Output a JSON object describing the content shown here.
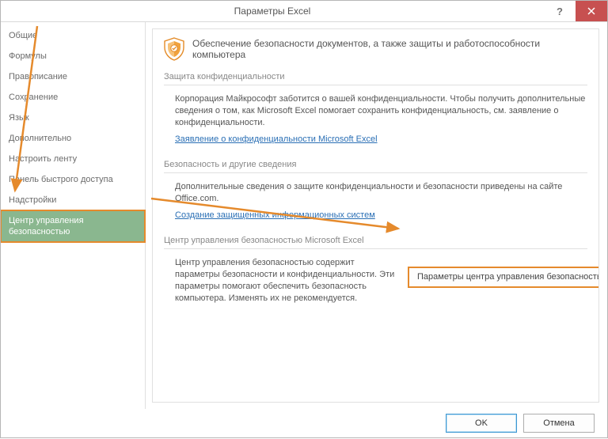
{
  "title": "Параметры Excel",
  "sidebar": {
    "items": [
      {
        "label": "Общие"
      },
      {
        "label": "Формулы"
      },
      {
        "label": "Правописание"
      },
      {
        "label": "Сохранение"
      },
      {
        "label": "Язык"
      },
      {
        "label": "Дополнительно"
      },
      {
        "label": "Настроить ленту"
      },
      {
        "label": "Панель быстрого доступа"
      },
      {
        "label": "Надстройки"
      },
      {
        "label": "Центр управления безопасностью"
      }
    ],
    "selected_index": 9
  },
  "main": {
    "header": "Обеспечение безопасности документов, а также защиты и работоспособности компьютера",
    "sections": [
      {
        "title": "Защита конфиденциальности",
        "text": "Корпорация Майкрософт заботится о вашей конфиденциальности. Чтобы получить дополнительные сведения о том, как Microsoft Excel помогает сохранить конфиденциальность, см. заявление о конфиденциальности.",
        "link": "Заявление о конфиденциальности Microsoft Excel"
      },
      {
        "title": "Безопасность и другие сведения",
        "text": "Дополнительные сведения о защите конфиденциальности и безопасности приведены на сайте Office.com.",
        "link": "Создание защищенных информационных систем"
      },
      {
        "title": "Центр управления безопасностью Microsoft Excel",
        "text": "Центр управления безопасностью содержит параметры безопасности и конфиденциальности. Эти параметры помогают обеспечить безопасность компьютера. Изменять их не рекомендуется.",
        "button": "Параметры центра управления безопасностью..."
      }
    ]
  },
  "footer": {
    "ok": "OK",
    "cancel": "Отмена"
  }
}
